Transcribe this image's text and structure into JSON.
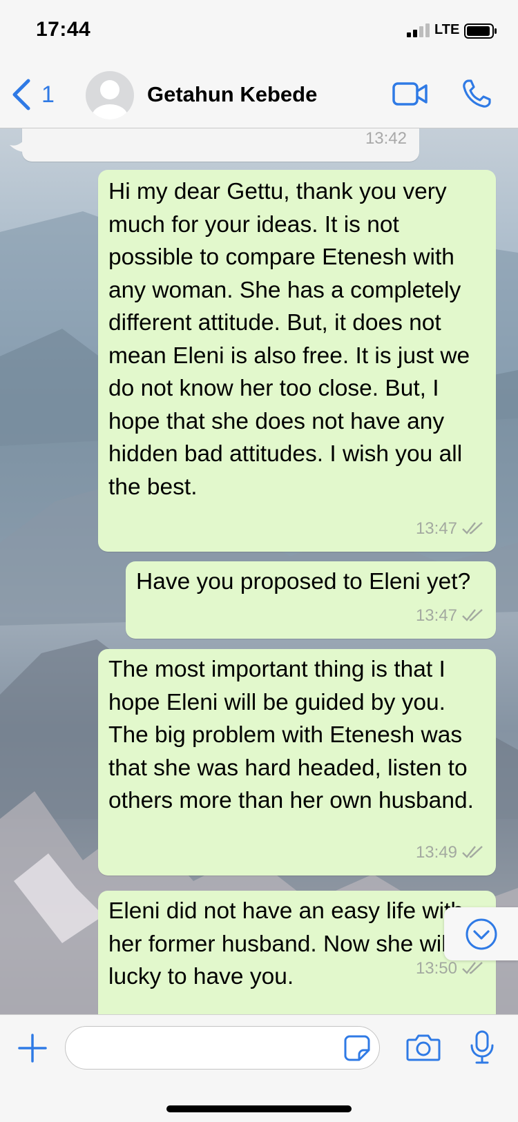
{
  "status_bar": {
    "time": "17:44",
    "network": "LTE",
    "icons": [
      "signal-icon",
      "battery-icon"
    ]
  },
  "header": {
    "back_icon": "chevron-left-icon",
    "back_count": "1",
    "contact_name": "Getahun Kebede",
    "avatar_icon": "person-silhouette-icon",
    "actions": [
      "video-camera-icon",
      "phone-icon"
    ]
  },
  "colors": {
    "accent": "#2f7ae5",
    "outgoing_bubble": "#e2f8cc",
    "incoming_bubble": "#f4f4f4",
    "timestamp": "#a3a9a0"
  },
  "messages": [
    {
      "direction": "incoming",
      "text": "",
      "time": "13:42"
    },
    {
      "direction": "outgoing",
      "text": "Hi my dear Gettu, thank you very much for your ideas. It is not possible to compare Etenesh with any woman. She has a completely different attitude. But, it does not mean Eleni is also free. It is just we do not know her too close. But, I hope that she does not have any hidden bad attitudes. I wish you all the best.",
      "time": "13:47",
      "status": "read"
    },
    {
      "direction": "outgoing",
      "text": "Have you proposed to Eleni yet?",
      "time": "13:47",
      "status": "read"
    },
    {
      "direction": "outgoing",
      "text": "The most important thing is that I hope Eleni will be guided by you. The big problem with Etenesh was that she was hard headed, listen to others more than her own husband.",
      "time": "13:49",
      "status": "read"
    },
    {
      "direction": "outgoing",
      "text": "Eleni did not have an easy life with her former husband. Now she will be lucky to have you.",
      "time": "13:50",
      "status": "read"
    }
  ],
  "scroll_button_icon": "chevron-down-circle-icon",
  "composer": {
    "placeholder": "",
    "icons": [
      "plus-icon",
      "sticker-icon",
      "camera-icon",
      "microphone-icon"
    ]
  }
}
